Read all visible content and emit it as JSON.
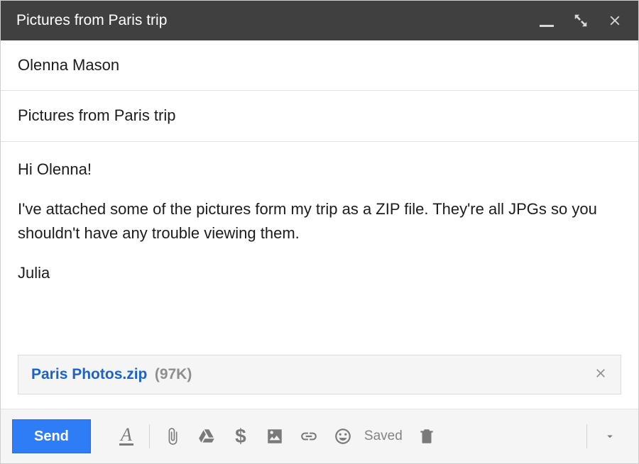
{
  "header": {
    "title": "Pictures from Paris trip"
  },
  "fields": {
    "to": "Olenna Mason",
    "subject": "Pictures from Paris trip"
  },
  "body": {
    "greeting": "Hi Olenna!",
    "paragraph": "I've attached some of the pictures form my trip as a ZIP file. They're all JPGs so you shouldn't have any trouble viewing them.",
    "signature": "Julia"
  },
  "attachment": {
    "filename": "Paris Photos.zip",
    "size": "(97K)"
  },
  "toolbar": {
    "send_label": "Send",
    "saved_label": "Saved"
  }
}
